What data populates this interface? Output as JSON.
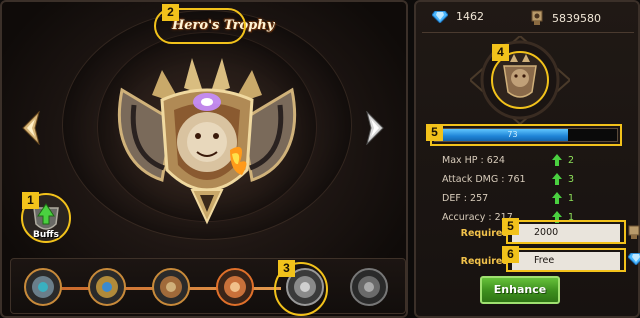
{
  "trophy": {
    "title": "Hero's Trophy"
  },
  "buffs": {
    "label": "Buffs"
  },
  "callouts": [
    "1",
    "2",
    "3",
    "4",
    "5",
    "5",
    "6"
  ],
  "currency": {
    "gems": "1462",
    "gold": "5839580"
  },
  "exp": {
    "text": "73",
    "progress": 0.73
  },
  "stats": [
    {
      "label": "Max HP : 624",
      "bonus": "2"
    },
    {
      "label": "Attack DMG : 761",
      "bonus": "3"
    },
    {
      "label": "DEF : 257",
      "bonus": "1"
    },
    {
      "label": "Accuracy : 217",
      "bonus": "1"
    }
  ],
  "requirements": [
    {
      "label": "Requires",
      "value": "2000",
      "icon": "gold-icon"
    },
    {
      "label": "Requires",
      "value": "Free",
      "icon": "gem-icon"
    }
  ],
  "enhance_button": "Enhance",
  "level_nodes": [
    "level-1",
    "level-2",
    "level-3",
    "level-4",
    "level-5-selected",
    "level-6-locked"
  ],
  "colors": {
    "accent": "#f2c21b",
    "exp_bar": "#1f84d6",
    "bonus": "#8fe15a",
    "button": "#3c8e1d"
  }
}
